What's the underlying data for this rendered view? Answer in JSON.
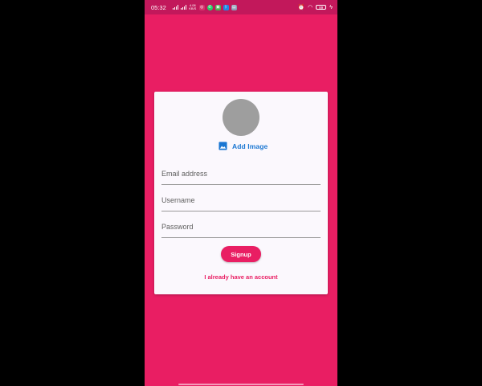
{
  "status_bar": {
    "time": "05:32",
    "network_speed": "4.08 KB/S",
    "notification_icons": [
      "instagram-icon",
      "whatsapp-icon",
      "gallery-icon",
      "bluetooth-icon",
      "photos-icon"
    ],
    "battery": "89",
    "battery_level": 0.89
  },
  "signup_form": {
    "add_image_label": "Add Image",
    "email_placeholder": "Email address",
    "username_placeholder": "Username",
    "password_placeholder": "Password",
    "signup_label": "Signup",
    "login_link": "I already have an account"
  },
  "colors": {
    "background": "#e91e63",
    "status_bar": "#c2185b",
    "card": "#fbf8fd",
    "accent_link": "#1976d2",
    "avatar_placeholder": "#9e9e9e"
  }
}
